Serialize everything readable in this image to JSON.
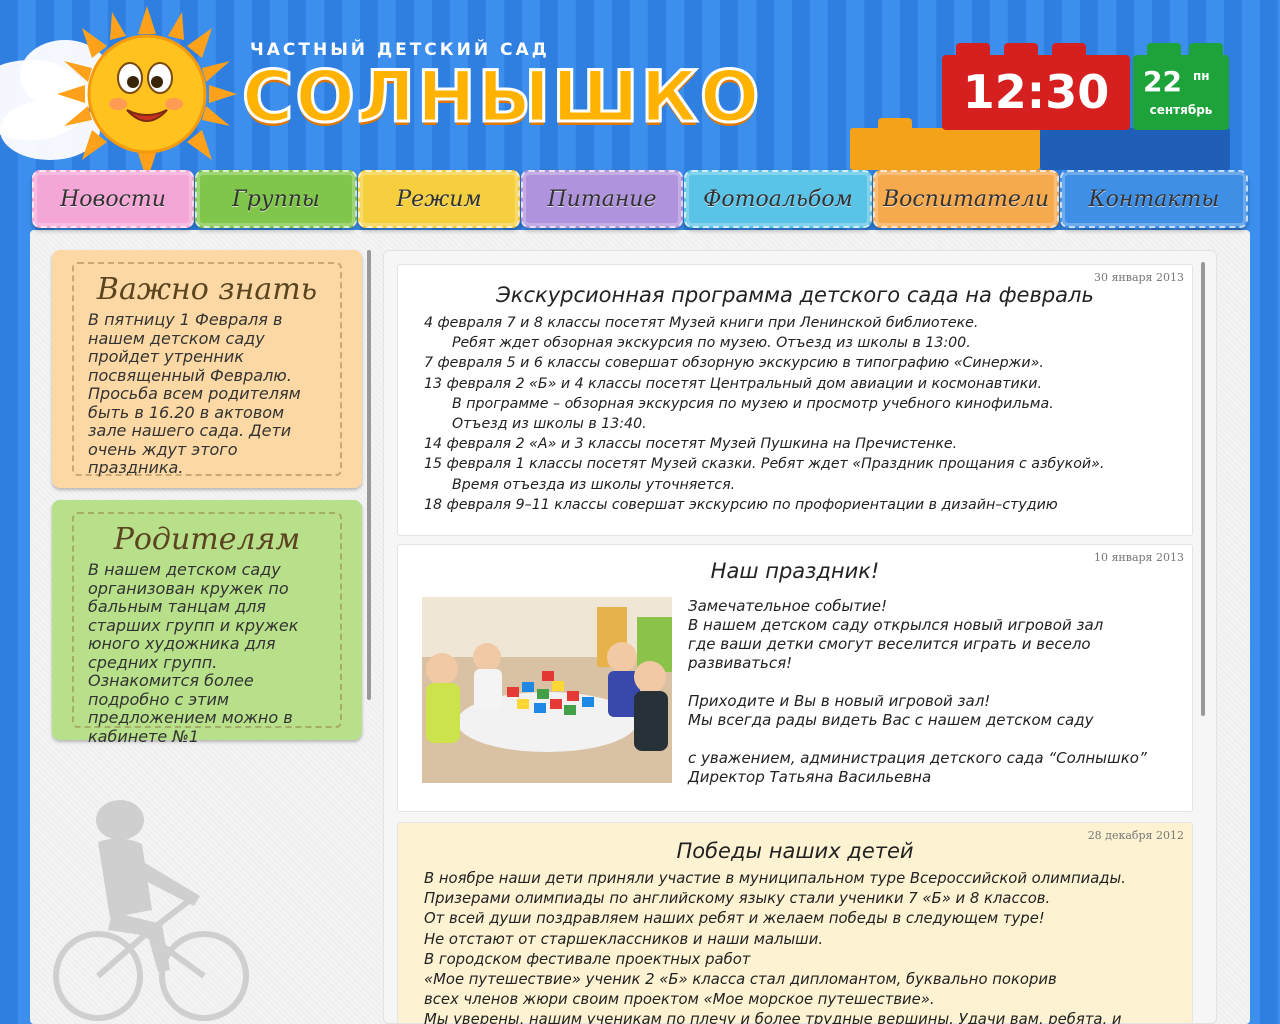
{
  "header": {
    "subtitle": "частный детский сад",
    "title": "СОЛНЫШКО",
    "clock": {
      "time": "12:30",
      "day": "22",
      "weekday": "пн",
      "month": "сентябрь"
    }
  },
  "nav": {
    "items": [
      {
        "label": "Новости",
        "color": "#f4a6d6"
      },
      {
        "label": "Группы",
        "color": "#7fc64a"
      },
      {
        "label": "Режим",
        "color": "#f6cf3f"
      },
      {
        "label": "Питание",
        "color": "#b093dd"
      },
      {
        "label": "Фотоальбом",
        "color": "#5ac3e8"
      },
      {
        "label": "Воспитатели",
        "color": "#f7a94e"
      },
      {
        "label": "Контакты",
        "color": "#3f8fe6"
      }
    ]
  },
  "sidebar": {
    "important": {
      "title": "Важно знать",
      "text": "В пятницу 1 Февраля в нашем детском саду пройдет утренник посвященный Февралю. Просьба всем родителям быть в 16.20 в актовом зале нашего сада. Дети очень ждут этого праздника."
    },
    "parents": {
      "title": "Родителям",
      "text": "В нашем детском саду организован кружек по бальным танцам для старших групп и кружек юного художника для средних групп. Ознакомится более подробно с этим предложением можно в кабинете №1"
    }
  },
  "news": [
    {
      "date": "30 января 2013",
      "title": "Экскурсионная программа детского сада на февраль",
      "lines": [
        "4 февраля 7 и 8 классы посетят Музей книги при Ленинской библиотеке.",
        "Ребят ждет обзорная      экскурсия по музею. Отъезд из школы в 13:00.",
        "7 февраля 5 и 6 классы совершат обзорную экскурсию в типографию «Синержи».",
        "13 февраля 2 «Б» и 4 классы посетят Центральный дом авиации и  космонавтики.",
        "В программе – обзорная экскурсия по музею и просмотр учебного кинофильма.",
        "Отъезд из школы в 13:40.",
        "14 февраля 2 «А» и 3 классы посетят Музей Пушкина на Пречистенке.",
        "15 февраля 1 классы посетят Музей сказки. Ребят ждет «Праздник прощания с азбукой».",
        "Время отъезда из школы уточняется.",
        "18 февраля 9–11 классы совершат экскурсию по профориентации в дизайн–студию"
      ]
    },
    {
      "date": "10 января 2013",
      "title": "Наш праздник!",
      "lines": [
        "Замечательное событие!",
        "В нашем детском саду открылся новый игровой зал",
        "где ваши детки смогут веселится играть и весело",
        "развиваться!",
        "",
        "Приходите и Вы в новый игровой зал!",
        "Мы всегда рады видеть Вас с нашем детском саду",
        "",
        "с уважением, администрация детского сада “Солнышко”",
        "Директор Татьяна Васильевна"
      ]
    },
    {
      "date": "28 декабря 2012",
      "title": "Победы наших детей",
      "lines": [
        "В ноябре наши дети приняли участие в муниципальном туре Всероссийской олимпиады.",
        "Призерами олимпиады по английскому языку стали ученики 7 «Б» и 8 классов.",
        "От всей души поздравляем наших ребят и желаем победы в следующем туре!",
        "Не отстают от старшеклассников и наши малыши.",
        "В городском  фестивале проектных работ",
        "«Мое путешествие» ученик 2 «Б» класса стал дипломантом, буквально покорив",
        "всех членов жюри своим проектом «Мое морское путешествие».",
        "Мы уверены, нашим ученикам по плечу и более трудные вершины. Удачи вам, ребята, и"
      ]
    }
  ]
}
